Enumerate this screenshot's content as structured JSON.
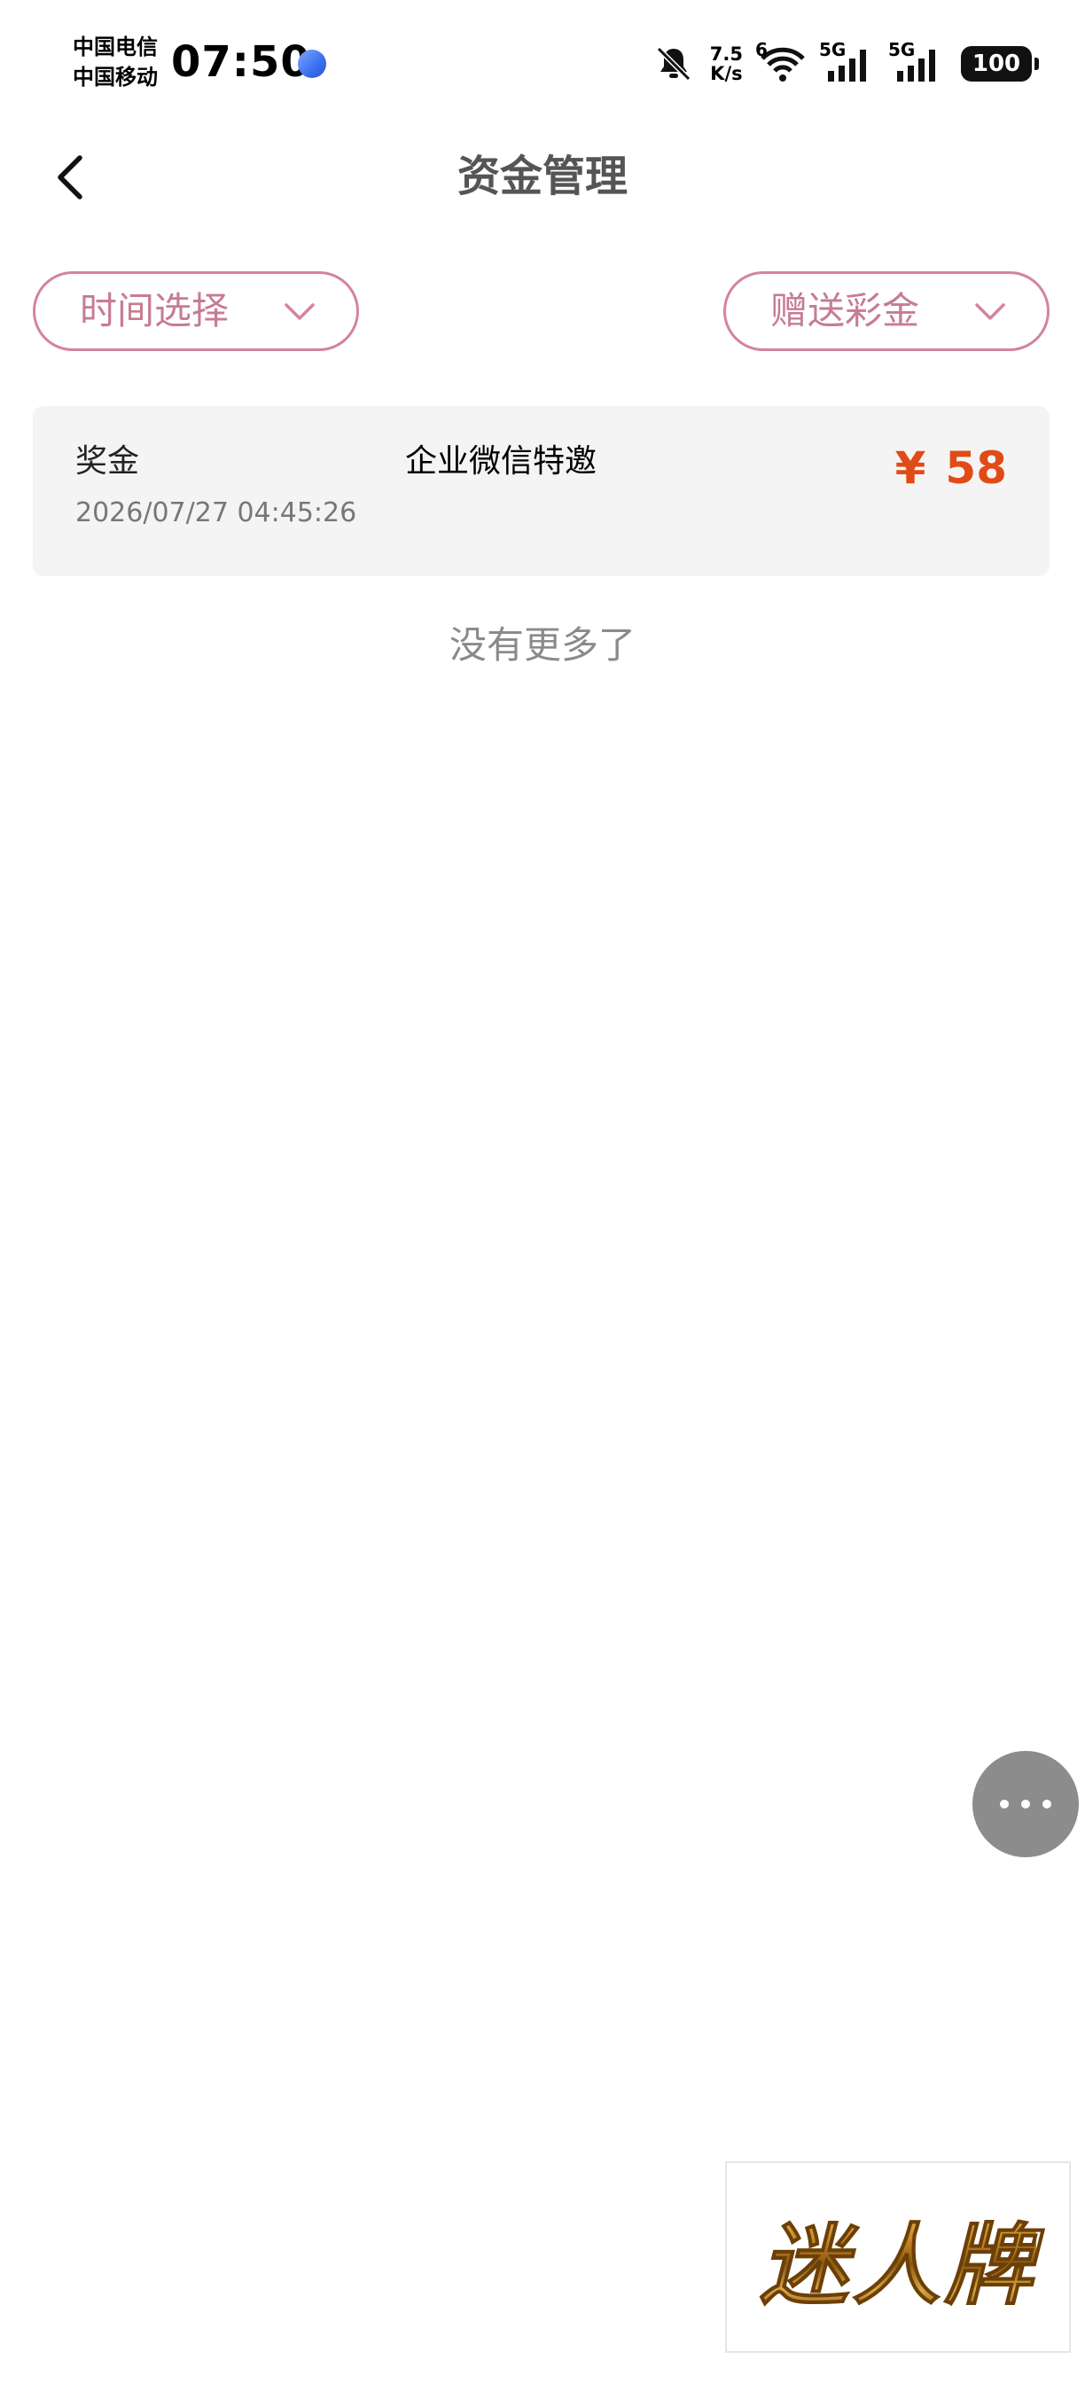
{
  "status_bar": {
    "carrier_1": "中国电信",
    "carrier_2": "中国移动",
    "time": "07:50",
    "net_speed_value": "7.5",
    "net_speed_unit": "K/s",
    "wifi_label": "6",
    "sim1_label": "5G",
    "sim2_label": "5G",
    "battery": "100",
    "icons": [
      "mute-bell-icon",
      "wifi-icon",
      "signal-icon",
      "battery-icon"
    ]
  },
  "header": {
    "title": "资金管理"
  },
  "filters": {
    "time_label": "时间选择",
    "type_label": "赠送彩金"
  },
  "records": [
    {
      "type": "奖金",
      "description": "企业微信特邀",
      "time": "2026/07/27 04:45:26",
      "currency": "¥",
      "amount": "58"
    }
  ],
  "list_footer": "没有更多了",
  "brand": {
    "logo_text": "迷人牌"
  },
  "colors": {
    "accent_pink": "#c67c92",
    "amount_orange": "#e04b16",
    "card_bg": "#f4f4f4"
  }
}
